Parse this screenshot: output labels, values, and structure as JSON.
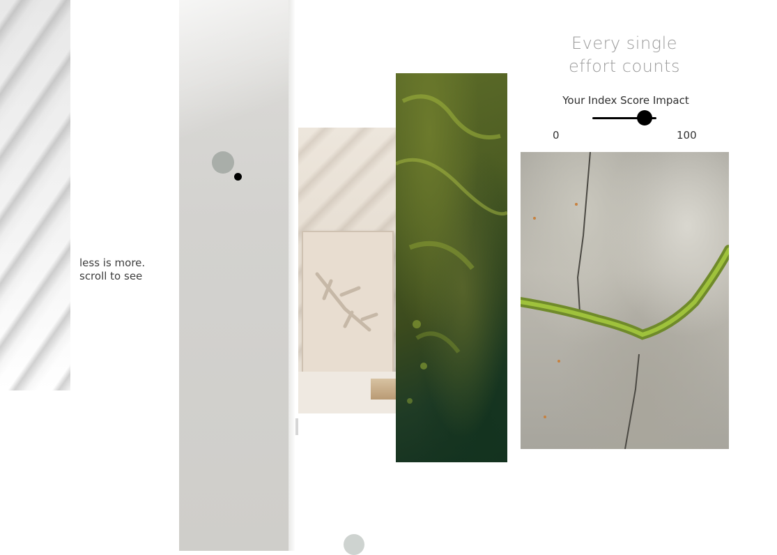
{
  "tagline": {
    "line1": "less is more.",
    "line2": "scroll to see"
  },
  "headline": {
    "line1": "Every single",
    "line2": "effort counts"
  },
  "slider": {
    "label": "Your Index Score Impact",
    "min_label": "0",
    "max_label": "100",
    "value_fraction": 0.82
  },
  "images": {
    "shadow_strip": "window-shadow-photo",
    "paper_panel": "grey-paper-texture",
    "room_photo": "framed-canvas-room-photo",
    "moss_photo": "aerial-moss-sand-photo",
    "crack_photo": "concrete-crack-moss-photo"
  },
  "colors": {
    "accent": "#000000",
    "cursor_ring": "#a9aea9",
    "headline_text": "#9a9a9a"
  }
}
